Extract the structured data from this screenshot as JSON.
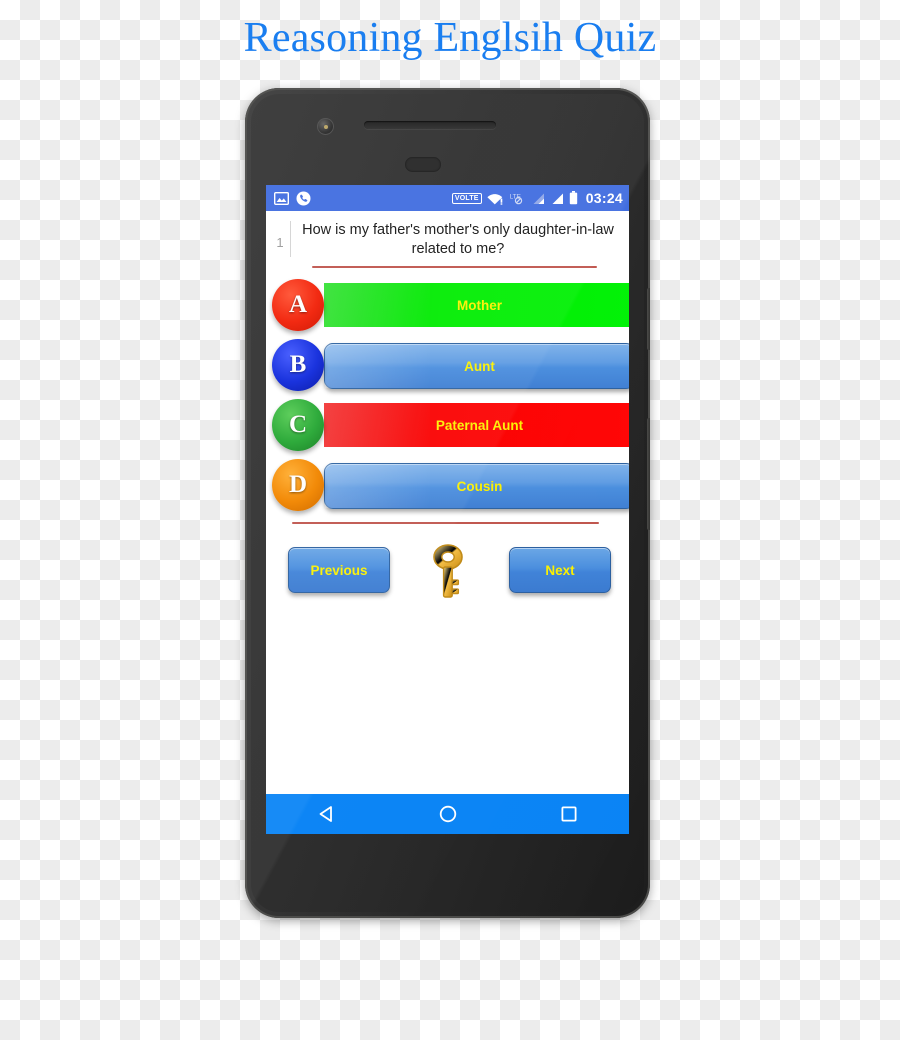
{
  "page": {
    "title": "Reasoning Englsih Quiz",
    "title_color": "#1a7ef0",
    "background": "transparent-checkerboard"
  },
  "device": {
    "type": "android-phone",
    "body_color": "#2b2b2b"
  },
  "status_bar": {
    "background_color": "#3f6cdf",
    "left_icons": [
      "image-icon",
      "phone-call-icon"
    ],
    "right_icons": [
      "volte-badge",
      "wifi-alert-icon",
      "lte-off-icon",
      "signal-bars-1-icon",
      "signal-bars-2-icon",
      "battery-icon"
    ],
    "volte_label": "VOLTE",
    "lte_label": "LTE",
    "time": "03:24"
  },
  "question": {
    "number": "1",
    "text": "How is my father's mother's only daughter-in-law related to me?",
    "divider_color": "#c0564e"
  },
  "options": [
    {
      "letter": "A",
      "label": "Mother",
      "circle_color": "#f22a12",
      "bar_style": "flat",
      "bar_color": "#00e800",
      "text_color": "#fbf000",
      "state": "correct"
    },
    {
      "letter": "B",
      "label": "Aunt",
      "circle_color": "#1a33dd",
      "bar_style": "pill",
      "bar_color": "#4a8ede",
      "text_color": "#fbf000",
      "state": "default"
    },
    {
      "letter": "C",
      "label": "Paternal Aunt",
      "circle_color": "#2fab3c",
      "bar_style": "flat",
      "bar_color": "#fb0000",
      "text_color": "#fbf000",
      "state": "wrong"
    },
    {
      "letter": "D",
      "label": "Cousin",
      "circle_color": "#f28a08",
      "bar_style": "pill",
      "bar_color": "#4a8ede",
      "text_color": "#fbf000",
      "state": "default"
    }
  ],
  "controls": {
    "previous_label": "Previous",
    "next_label": "Next",
    "key_icon": "key-icon",
    "button_text_color": "#fbf000"
  },
  "nav_bar": {
    "background_color": "#0a84f5",
    "buttons": [
      "back-triangle-icon",
      "home-circle-icon",
      "recents-square-icon"
    ]
  }
}
